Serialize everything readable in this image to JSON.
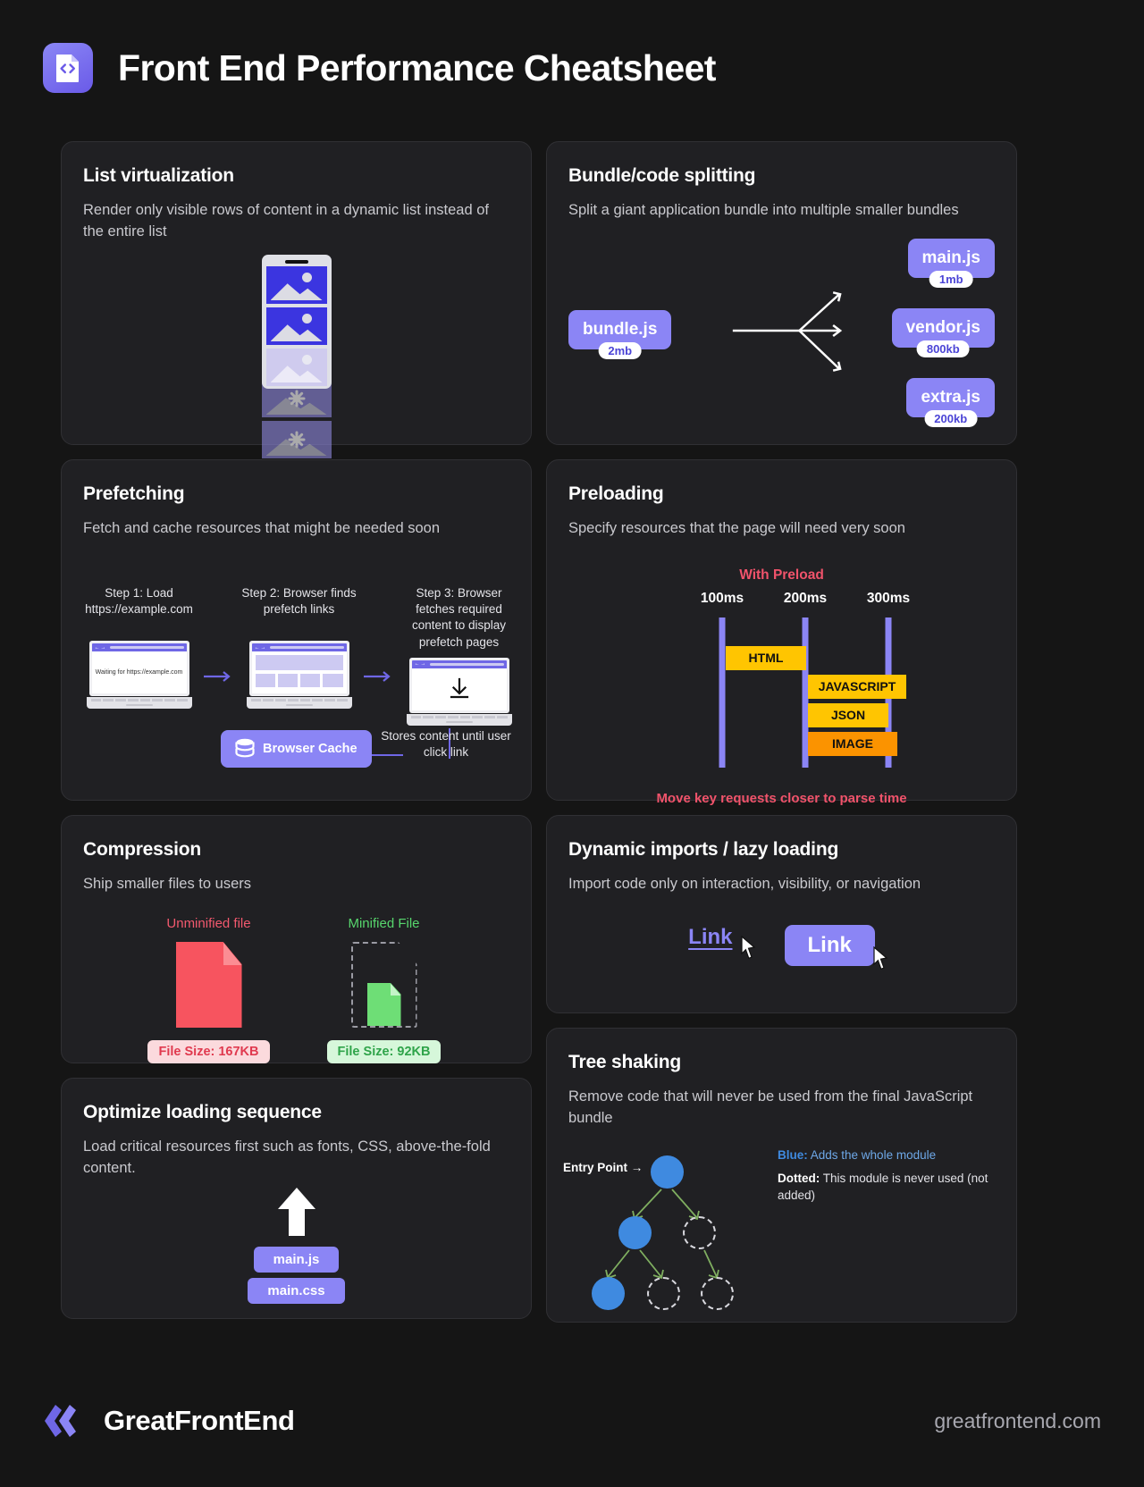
{
  "header": {
    "title": "Front End Performance Cheatsheet",
    "logo_icon": "code-document-icon"
  },
  "cards": {
    "list_virtualization": {
      "title": "List virtualization",
      "desc": "Render only visible rows of content in a dynamic list instead of the entire list"
    },
    "bundle_splitting": {
      "title": "Bundle/code splitting",
      "desc": "Split a giant application bundle into multiple smaller bundles",
      "source": {
        "name": "bundle.js",
        "size": "2mb"
      },
      "outputs": [
        {
          "name": "main.js",
          "size": "1mb"
        },
        {
          "name": "vendor.js",
          "size": "800kb"
        },
        {
          "name": "extra.js",
          "size": "200kb"
        }
      ]
    },
    "prefetching": {
      "title": "Prefetching",
      "desc": "Fetch and cache resources that might be needed soon",
      "steps": [
        {
          "label": "Step 1: Load https://example.com",
          "screen_text": "Waiting for https://example.com"
        },
        {
          "label": "Step 2: Browser finds prefetch links",
          "screen_text": ""
        },
        {
          "label": "Step 3: Browser fetches required content to display prefetch pages",
          "screen_text": ""
        }
      ],
      "cache_label": "Browser Cache",
      "cache_note": "Stores content until user click link"
    },
    "preloading": {
      "title": "Preloading",
      "desc": "Specify resources that the page will need very soon",
      "chart_title": "With Preload",
      "footer_note": "Move key requests closer to parse time"
    },
    "compression": {
      "title": "Compression",
      "desc": "Ship smaller files to users",
      "unminified_label": "Unminified file",
      "minified_label": "Minified File",
      "unminified_size": "File Size: 167KB",
      "minified_size": "File Size: 92KB"
    },
    "dynamic_imports": {
      "title": "Dynamic imports / lazy loading",
      "desc": "Import code only on interaction, visibility, or navigation",
      "link_plain": "Link",
      "link_button": "Link"
    },
    "tree_shaking": {
      "title": "Tree shaking",
      "desc": "Remove code that will never be used from the final JavaScript bundle",
      "entry_label": "Entry Point →",
      "legend": [
        {
          "term": "Blue:",
          "text": "Adds the whole module"
        },
        {
          "term": "Dotted:",
          "text": "This module is never used (not added)"
        }
      ]
    },
    "optimize_loading": {
      "title": "Optimize loading sequence",
      "desc": "Load critical resources first such as fonts, CSS, above-the-fold content.",
      "assets": [
        "main.js",
        "main.css"
      ]
    }
  },
  "chart_data": {
    "type": "bar",
    "title": "With Preload",
    "subtitle": "Move key requests closer to parse time",
    "xlabel": "",
    "ylabel": "",
    "orientation": "horizontal",
    "axis_ticks": [
      "100ms",
      "200ms",
      "300ms"
    ],
    "tick_values": [
      100,
      200,
      300
    ],
    "xlim": [
      60,
      340
    ],
    "grid": false,
    "legend": "none",
    "categories": [
      "HTML",
      "JAVASCRIPT",
      "JSON",
      "IMAGE"
    ],
    "bars": [
      {
        "label": "HTML",
        "start": 105,
        "end": 195,
        "color": "#ffc501"
      },
      {
        "label": "JAVASCRIPT",
        "start": 200,
        "end": 310,
        "color": "#ffc501"
      },
      {
        "label": "JSON",
        "start": 200,
        "end": 290,
        "color": "#ffc501"
      },
      {
        "label": "IMAGE",
        "start": 200,
        "end": 300,
        "color": "#fb9300"
      }
    ]
  },
  "footer": {
    "brand": "GreatFrontEnd",
    "url": "greatfrontend.com"
  },
  "colors": {
    "background": "#151515",
    "card": "#202023",
    "accent_purple": "#8b85f5",
    "red": "#f2596e",
    "green": "#57d66d",
    "yellow": "#ffc501",
    "orange": "#fb9300",
    "blue_node": "#3f8ae0"
  }
}
